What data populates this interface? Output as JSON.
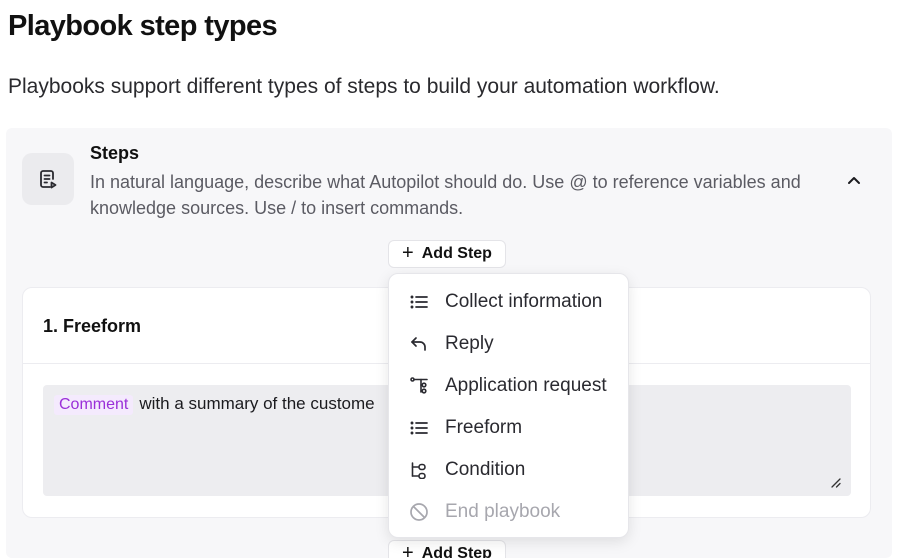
{
  "page": {
    "title": "Playbook step types",
    "subtitle": "Playbooks support different types of steps to build your automation workflow."
  },
  "steps_section": {
    "title": "Steps",
    "description": "In natural language, describe what Autopilot should do. Use @ to reference variables and knowledge sources. Use / to insert commands.",
    "add_step_label": "Add Step",
    "add_step_bottom_label": "Add Step"
  },
  "step_card": {
    "title": "1. Freeform",
    "tag": "Comment",
    "text": "with a summary of the custome"
  },
  "menu": {
    "items": [
      {
        "label": "Collect information",
        "icon": "list-icon",
        "enabled": true
      },
      {
        "label": "Reply",
        "icon": "reply-icon",
        "enabled": true
      },
      {
        "label": "Application request",
        "icon": "application-request-icon",
        "enabled": true
      },
      {
        "label": "Freeform",
        "icon": "list-icon",
        "enabled": true
      },
      {
        "label": "Condition",
        "icon": "condition-icon",
        "enabled": true
      },
      {
        "label": "End playbook",
        "icon": "block-icon",
        "enabled": false
      }
    ]
  },
  "colors": {
    "tag_text": "#9a2fd8",
    "tag_bg": "#f4eafd",
    "panel_bg": "#f7f7f9",
    "editor_bg": "#ededf0"
  }
}
